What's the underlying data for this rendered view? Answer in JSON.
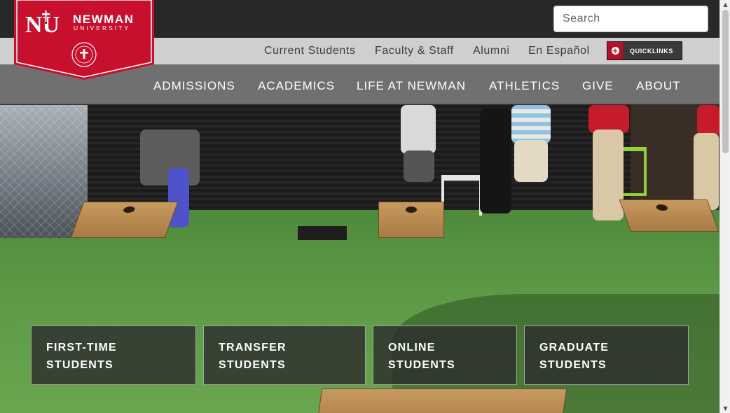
{
  "brand": {
    "name": "NEWMAN",
    "sub": "UNIVERSITY",
    "monogram": "NU",
    "logo_color": "#c8102e"
  },
  "search": {
    "placeholder": "Search"
  },
  "utility_nav": [
    {
      "label": "Current Students"
    },
    {
      "label": "Faculty & Staff"
    },
    {
      "label": "Alumni"
    },
    {
      "label": "En Español"
    }
  ],
  "quicklinks": {
    "label": "QUICKLINKS",
    "icon": "plus-circle-icon"
  },
  "main_nav": [
    {
      "label": "ADMISSIONS"
    },
    {
      "label": "ACADEMICS"
    },
    {
      "label": "LIFE AT NEWMAN"
    },
    {
      "label": "ATHLETICS"
    },
    {
      "label": "GIVE"
    },
    {
      "label": "ABOUT"
    }
  ],
  "audience_cards": [
    {
      "line1": "FIRST-TIME",
      "line2": "STUDENTS"
    },
    {
      "line1": "TRANSFER",
      "line2": "STUDENTS"
    },
    {
      "line1": "ONLINE",
      "line2": "STUDENTS"
    },
    {
      "line1": "GRADUATE",
      "line2": "STUDENTS"
    }
  ],
  "colors": {
    "brand_red": "#c8102e",
    "nav_gray": "#787878"
  }
}
